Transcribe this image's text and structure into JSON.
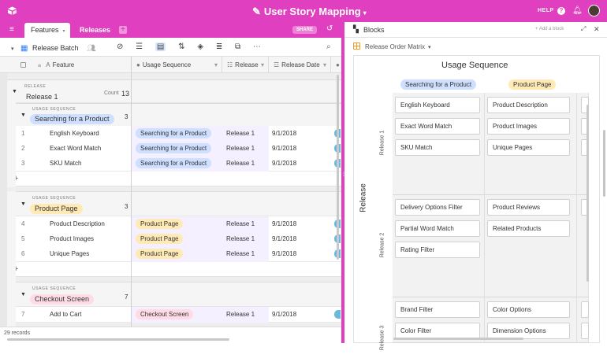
{
  "app": {
    "title": "User Story Mapping",
    "help": "HELP"
  },
  "tabs": {
    "features": "Features",
    "releases": "Releases",
    "share": "SHARE"
  },
  "toolbar": {
    "view_name": "Release Batch"
  },
  "columns": {
    "feature": "Feature",
    "usage": "Usage Sequence",
    "release": "Release",
    "release_date": "Release Date"
  },
  "group1": {
    "caption": "RELEASE",
    "value": "Release 1",
    "count_label": "Count",
    "count": "13"
  },
  "subgroups": [
    {
      "caption": "USAGE SEQUENCE",
      "value": "Searching for a Product",
      "count": "3",
      "color": "#cfdfff"
    },
    {
      "caption": "USAGE SEQUENCE",
      "value": "Product Page",
      "count": "3",
      "color": "#ffeab6"
    },
    {
      "caption": "USAGE SEQUENCE",
      "value": "Checkout Screen",
      "count": "7",
      "color": "#ffdce5"
    }
  ],
  "rows": [
    {
      "n": "1",
      "feature": "English Keyboard",
      "usage": "Searching for a Product",
      "release": "Release 1",
      "date": "9/1/2018"
    },
    {
      "n": "2",
      "feature": "Exact Word Match",
      "usage": "Searching for a Product",
      "release": "Release 1",
      "date": "9/1/2018"
    },
    {
      "n": "3",
      "feature": "SKU Match",
      "usage": "Searching for a Product",
      "release": "Release 1",
      "date": "9/1/2018"
    },
    {
      "n": "4",
      "feature": "Product Description",
      "usage": "Product Page",
      "release": "Release 1",
      "date": "9/1/2018"
    },
    {
      "n": "5",
      "feature": "Product Images",
      "usage": "Product Page",
      "release": "Release 1",
      "date": "9/1/2018"
    },
    {
      "n": "6",
      "feature": "Unique Pages",
      "usage": "Product Page",
      "release": "Release 1",
      "date": "9/1/2018"
    },
    {
      "n": "7",
      "feature": "Add to Cart",
      "usage": "Checkout Screen",
      "release": "Release 1",
      "date": "9/1/2018"
    }
  ],
  "footer": {
    "records": "29 records"
  },
  "blocks": {
    "title": "Blocks",
    "add_block": "+ Add a block",
    "matrix_name": "Release Order Matrix",
    "usage_label": "Usage Sequence",
    "release_label": "Release",
    "col_pills": [
      {
        "label": "Searching for a Product",
        "color": "#cfdfff"
      },
      {
        "label": "Product Page",
        "color": "#ffeab6"
      }
    ],
    "row_labels": [
      "Release 1",
      "Release 2",
      "Release 3"
    ],
    "cards": {
      "r1c1": [
        "English Keyboard",
        "Exact Word Match",
        "SKU Match"
      ],
      "r1c2": [
        "Product Description",
        "Product Images",
        "Unique Pages"
      ],
      "r2c1": [
        "Delivery Options Filter",
        "Partial Word Match",
        "Rating Filter"
      ],
      "r2c2": [
        "Product Reviews",
        "Related Products"
      ],
      "r3c1": [
        "Brand Filter",
        "Color Filter"
      ],
      "r3c2": [
        "Color Options",
        "Dimension Options"
      ]
    }
  }
}
